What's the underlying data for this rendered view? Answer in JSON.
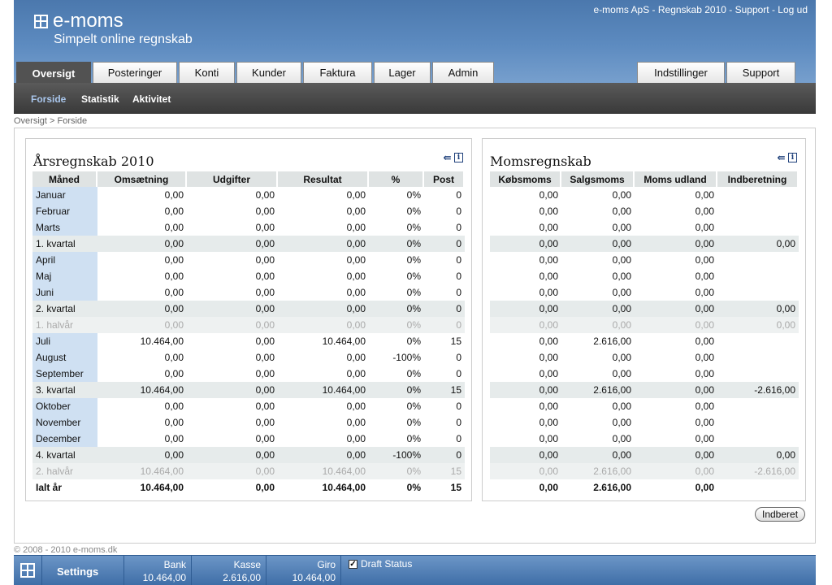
{
  "header": {
    "logo_text": "e-moms",
    "tagline": "Simpelt online regnskab",
    "top_links": "e-moms ApS - Regnskab 2010 - Support - Log ud"
  },
  "tabs": [
    {
      "label": "Oversigt",
      "active": true
    },
    {
      "label": "Posteringer"
    },
    {
      "label": "Konti"
    },
    {
      "label": "Kunder"
    },
    {
      "label": "Faktura"
    },
    {
      "label": "Lager"
    },
    {
      "label": "Admin"
    },
    {
      "label": "Indstillinger"
    },
    {
      "label": "Support"
    }
  ],
  "subnav": [
    {
      "label": "Forside",
      "active": true
    },
    {
      "label": "Statistik"
    },
    {
      "label": "Aktivitet"
    }
  ],
  "breadcrumb": "Oversigt > Forside",
  "aars": {
    "title": "Årsregnskab 2010",
    "headers": [
      "Måned",
      "Omsætning",
      "Udgifter",
      "Resultat",
      "%",
      "Post"
    ],
    "rows": [
      [
        "Januar",
        "0,00",
        "0,00",
        "0,00",
        "0%",
        "0"
      ],
      [
        "Februar",
        "0,00",
        "0,00",
        "0,00",
        "0%",
        "0"
      ],
      [
        "Marts",
        "0,00",
        "0,00",
        "0,00",
        "0%",
        "0"
      ],
      [
        "1. kvartal",
        "0,00",
        "0,00",
        "0,00",
        "0%",
        "0"
      ],
      [
        "April",
        "0,00",
        "0,00",
        "0,00",
        "0%",
        "0"
      ],
      [
        "Maj",
        "0,00",
        "0,00",
        "0,00",
        "0%",
        "0"
      ],
      [
        "Juni",
        "0,00",
        "0,00",
        "0,00",
        "0%",
        "0"
      ],
      [
        "2. kvartal",
        "0,00",
        "0,00",
        "0,00",
        "0%",
        "0"
      ],
      [
        "1. halvår",
        "0,00",
        "0,00",
        "0,00",
        "0%",
        "0"
      ],
      [
        "Juli",
        "10.464,00",
        "0,00",
        "10.464,00",
        "0%",
        "15"
      ],
      [
        "August",
        "0,00",
        "0,00",
        "0,00",
        "-100%",
        "0"
      ],
      [
        "September",
        "0,00",
        "0,00",
        "0,00",
        "0%",
        "0"
      ],
      [
        "3. kvartal",
        "10.464,00",
        "0,00",
        "10.464,00",
        "0%",
        "15"
      ],
      [
        "Oktober",
        "0,00",
        "0,00",
        "0,00",
        "0%",
        "0"
      ],
      [
        "November",
        "0,00",
        "0,00",
        "0,00",
        "0%",
        "0"
      ],
      [
        "December",
        "0,00",
        "0,00",
        "0,00",
        "0%",
        "0"
      ],
      [
        "4. kvartal",
        "0,00",
        "0,00",
        "0,00",
        "-100%",
        "0"
      ],
      [
        "2. halvår",
        "10.464,00",
        "0,00",
        "10.464,00",
        "0%",
        "15"
      ],
      [
        "Ialt år",
        "10.464,00",
        "0,00",
        "10.464,00",
        "0%",
        "15"
      ]
    ]
  },
  "moms": {
    "title": "Momsregnskab",
    "headers": [
      "Købsmoms",
      "Salgsmoms",
      "Moms udland",
      "Indberetning"
    ],
    "rows": [
      [
        "0,00",
        "0,00",
        "0,00",
        ""
      ],
      [
        "0,00",
        "0,00",
        "0,00",
        ""
      ],
      [
        "0,00",
        "0,00",
        "0,00",
        ""
      ],
      [
        "0,00",
        "0,00",
        "0,00",
        "0,00"
      ],
      [
        "0,00",
        "0,00",
        "0,00",
        ""
      ],
      [
        "0,00",
        "0,00",
        "0,00",
        ""
      ],
      [
        "0,00",
        "0,00",
        "0,00",
        ""
      ],
      [
        "0,00",
        "0,00",
        "0,00",
        "0,00"
      ],
      [
        "0,00",
        "0,00",
        "0,00",
        "0,00"
      ],
      [
        "0,00",
        "2.616,00",
        "0,00",
        ""
      ],
      [
        "0,00",
        "0,00",
        "0,00",
        ""
      ],
      [
        "0,00",
        "0,00",
        "0,00",
        ""
      ],
      [
        "0,00",
        "2.616,00",
        "0,00",
        "-2.616,00"
      ],
      [
        "0,00",
        "0,00",
        "0,00",
        ""
      ],
      [
        "0,00",
        "0,00",
        "0,00",
        ""
      ],
      [
        "0,00",
        "0,00",
        "0,00",
        ""
      ],
      [
        "0,00",
        "0,00",
        "0,00",
        "0,00"
      ],
      [
        "0,00",
        "2.616,00",
        "0,00",
        "-2.616,00"
      ],
      [
        "0,00",
        "2.616,00",
        "0,00",
        ""
      ]
    ]
  },
  "row_kinds": [
    "m",
    "m",
    "m",
    "q",
    "m",
    "m",
    "m",
    "q",
    "h",
    "m",
    "m",
    "m",
    "q",
    "m",
    "m",
    "m",
    "q",
    "h",
    "s"
  ],
  "indberet_label": "Indberet",
  "copyright": "© 2008 - 2010 e-moms.dk",
  "bottombar": {
    "settings_label": "Settings",
    "accounts": [
      {
        "name": "Bank",
        "value": "10.464,00"
      },
      {
        "name": "Kasse",
        "value": "2.616,00"
      },
      {
        "name": "Giro",
        "value": "10.464,00"
      }
    ],
    "draft_label": "Draft Status",
    "draft_checked": true
  }
}
